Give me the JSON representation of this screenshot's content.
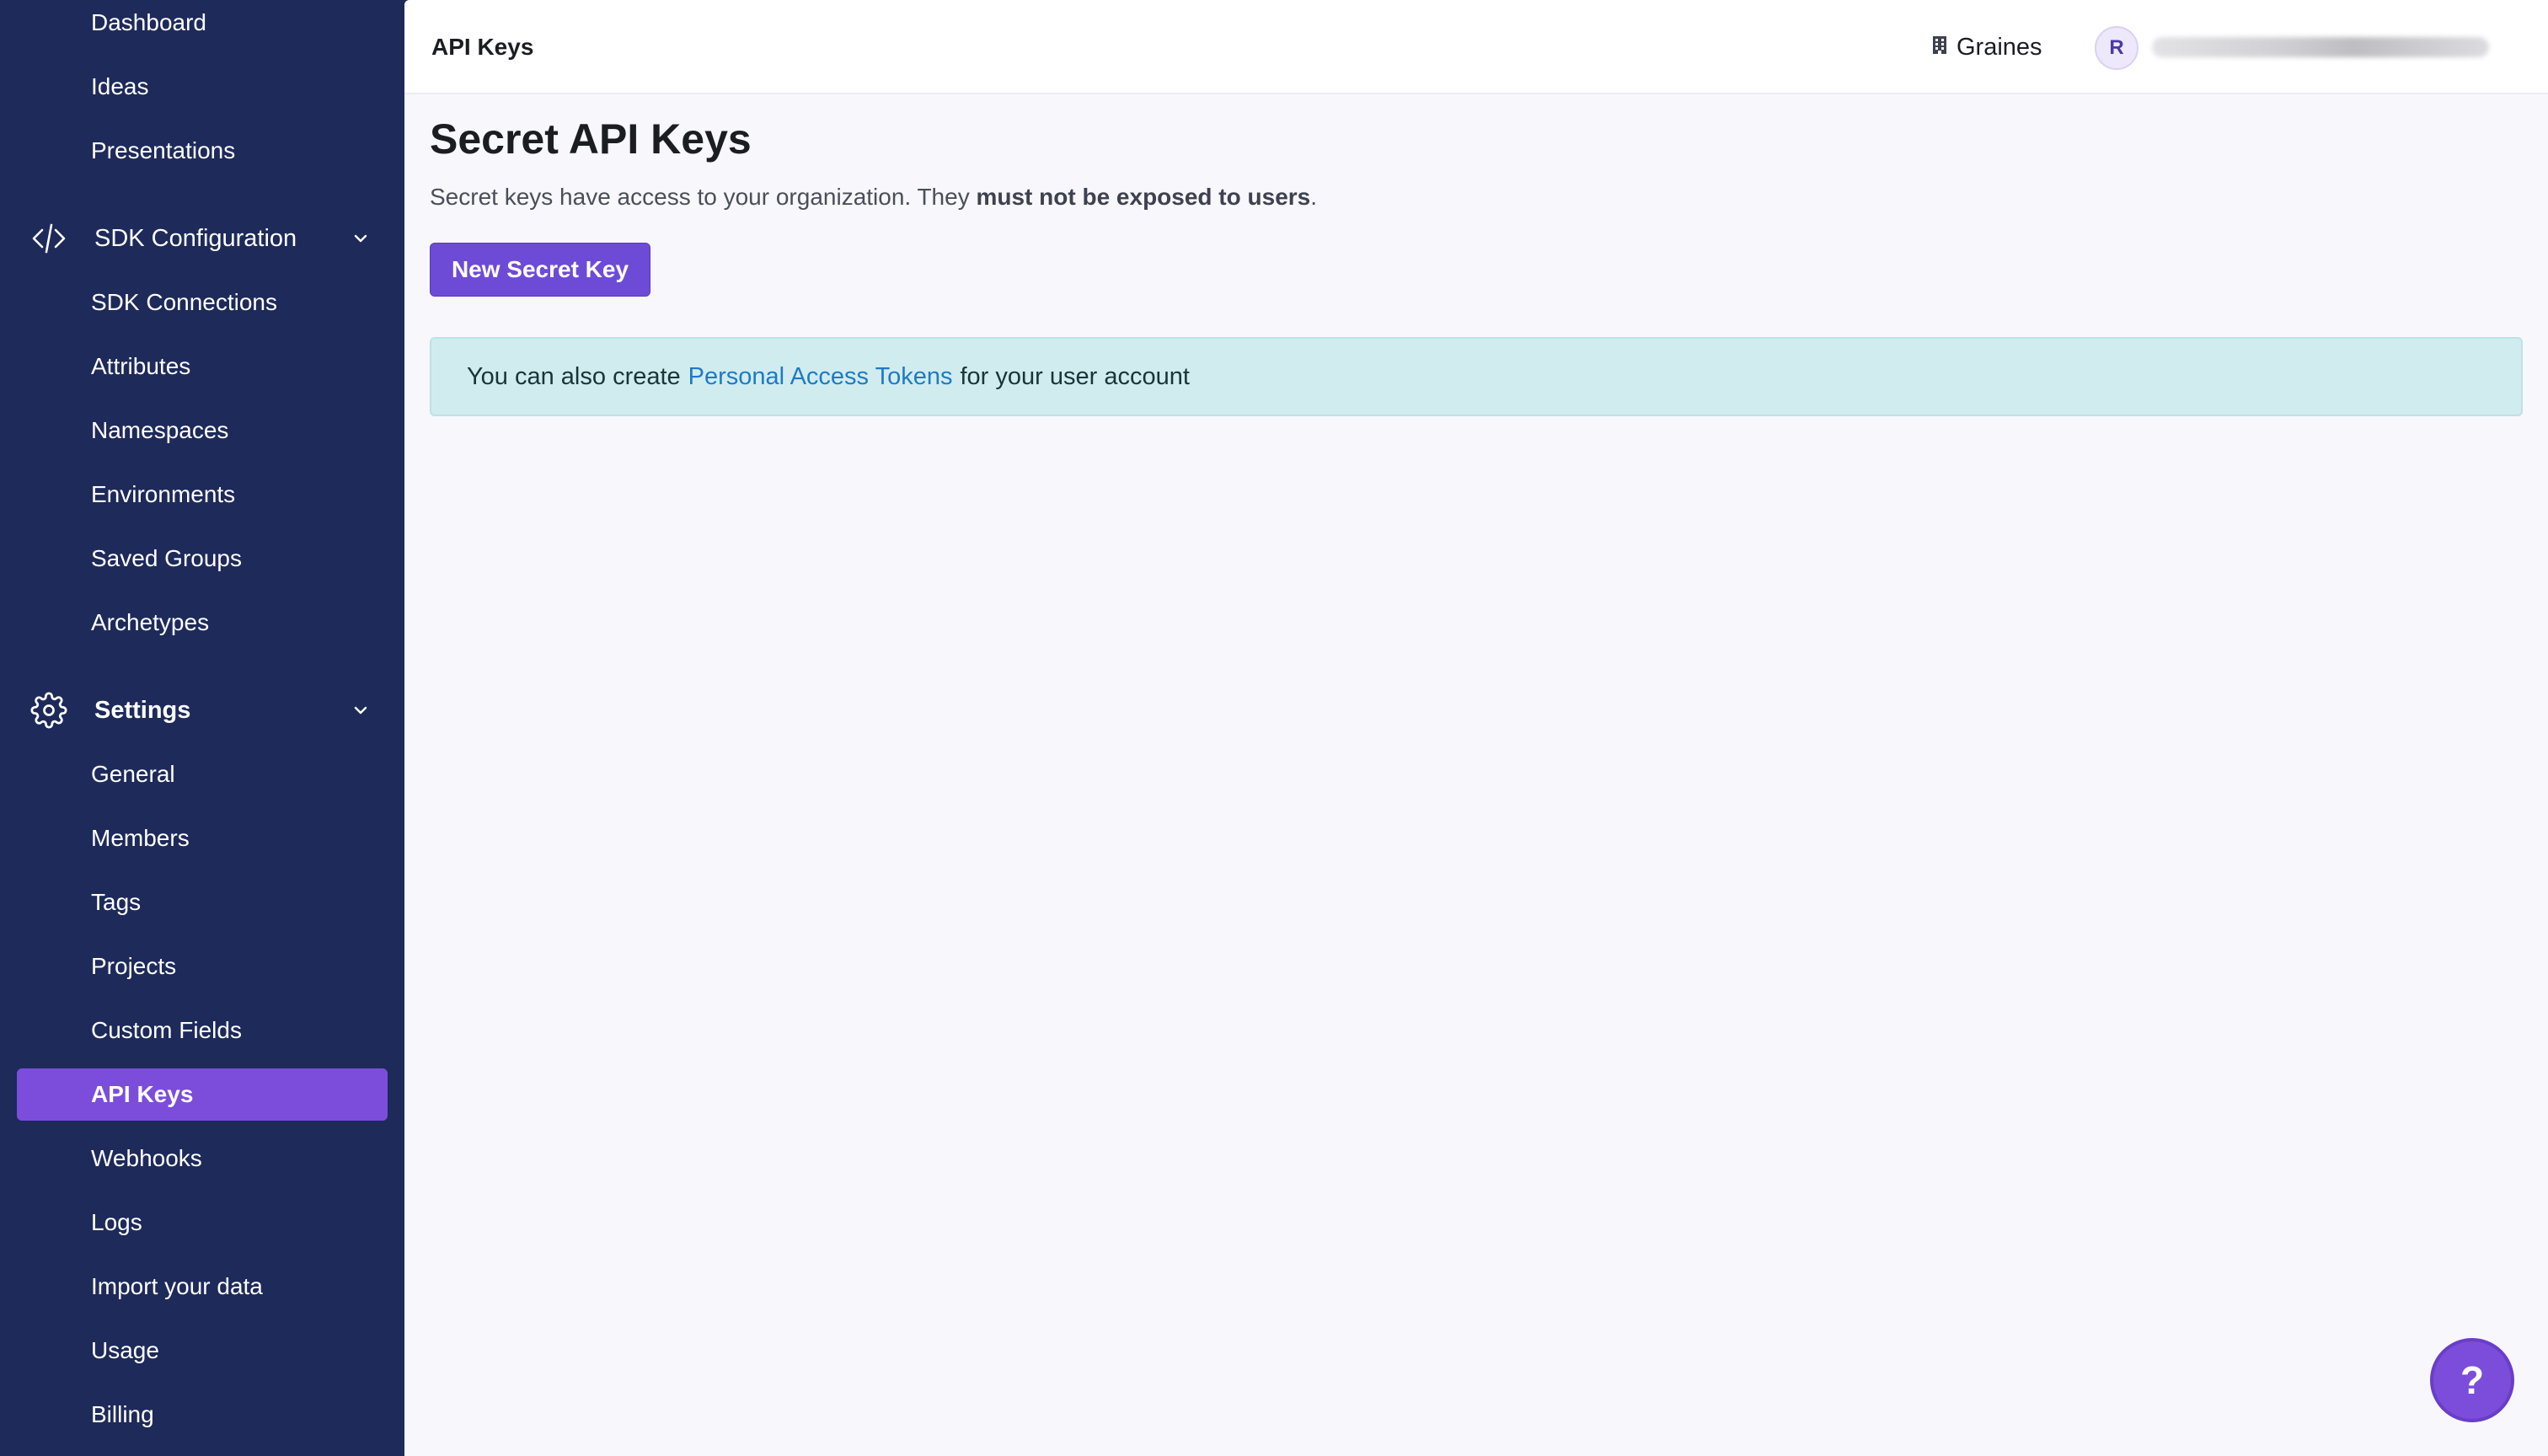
{
  "sidebar": {
    "top_items": [
      {
        "label": "Dashboard"
      },
      {
        "label": "Ideas"
      },
      {
        "label": "Presentations"
      }
    ],
    "sdk_section": {
      "label": "SDK Configuration",
      "icon": "code-icon",
      "items": [
        {
          "label": "SDK Connections"
        },
        {
          "label": "Attributes"
        },
        {
          "label": "Namespaces"
        },
        {
          "label": "Environments"
        },
        {
          "label": "Saved Groups"
        },
        {
          "label": "Archetypes"
        }
      ]
    },
    "settings_section": {
      "label": "Settings",
      "icon": "gear-icon",
      "items": [
        {
          "label": "General"
        },
        {
          "label": "Members"
        },
        {
          "label": "Tags"
        },
        {
          "label": "Projects"
        },
        {
          "label": "Custom Fields"
        },
        {
          "label": "API Keys",
          "active": true
        },
        {
          "label": "Webhooks"
        },
        {
          "label": "Logs"
        },
        {
          "label": "Import your data"
        },
        {
          "label": "Usage"
        },
        {
          "label": "Billing"
        }
      ]
    }
  },
  "header": {
    "breadcrumb": "API Keys",
    "org_name": "Graines",
    "avatar_initial": "R"
  },
  "main": {
    "title": "Secret API Keys",
    "description_prefix": "Secret keys have access to your organization. They ",
    "description_bold": "must not be exposed to users",
    "description_suffix": ".",
    "new_key_button": "New Secret Key",
    "callout": {
      "prefix": "You can also create",
      "link": "Personal Access Tokens",
      "suffix": "for your user account"
    }
  },
  "help_button": "?",
  "colors": {
    "sidebar_bg": "#1e2a5a",
    "accent": "#7c4ddb",
    "callout_bg": "#d1ecef",
    "link": "#1f7ac2"
  }
}
